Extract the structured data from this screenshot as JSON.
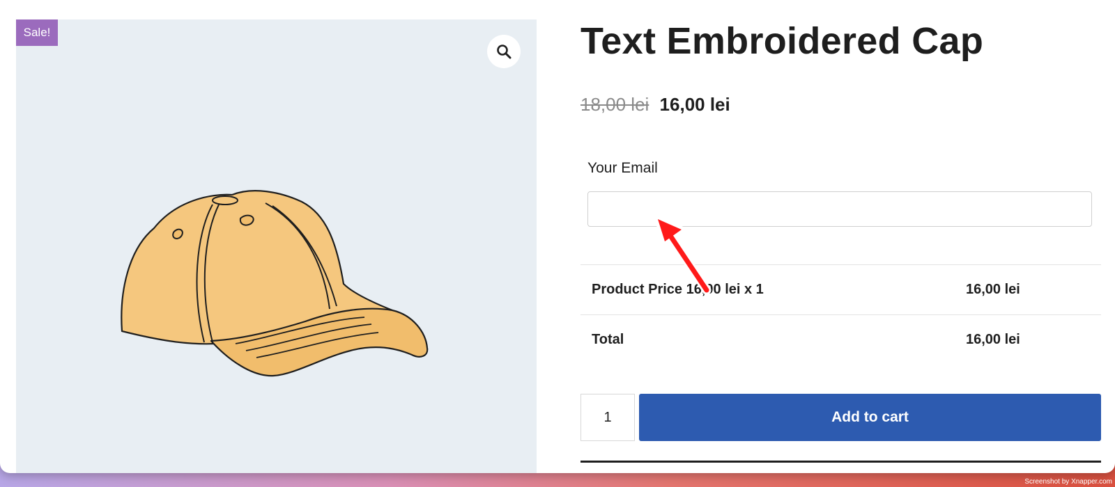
{
  "gallery": {
    "badge": "Sale!",
    "zoom_icon": "search-icon",
    "image_alt": "cap"
  },
  "product": {
    "title": "Text Embroidered Cap",
    "price_old": "18,00 lei",
    "price_new": "16,00 lei"
  },
  "form": {
    "email_label": "Your Email",
    "email_value": "",
    "email_placeholder": ""
  },
  "summary": {
    "rows": [
      {
        "label": "Product Price 16,00 lei x 1",
        "value": "16,00 lei"
      },
      {
        "label": "Total",
        "value": "16,00 lei"
      }
    ]
  },
  "cart": {
    "quantity": "1",
    "add_label": "Add to cart"
  },
  "colors": {
    "badge": "#9b6bbd",
    "button": "#2d5bb0",
    "annotation_arrow": "#ff1a1a"
  },
  "watermark": "Screenshot by Xnapper.com"
}
